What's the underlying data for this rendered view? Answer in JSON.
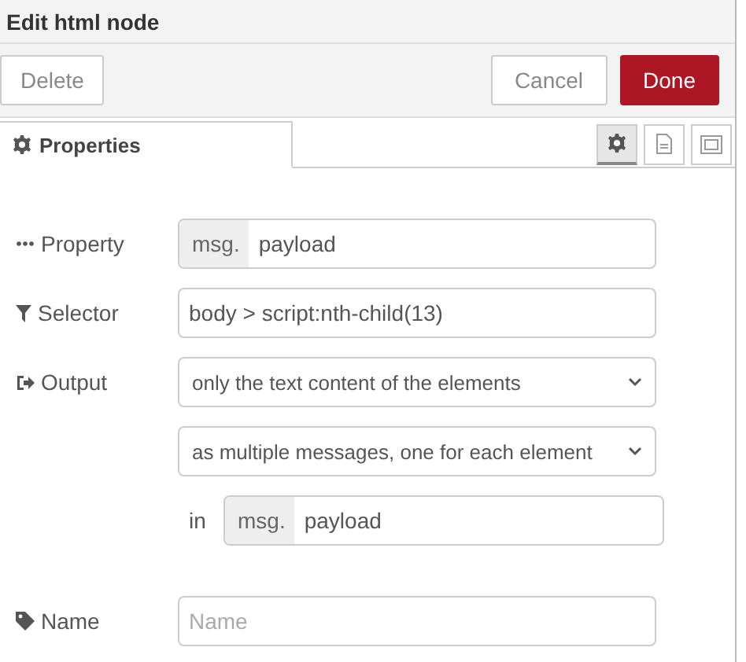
{
  "window": {
    "title": "Edit html node"
  },
  "buttons": [
    {
      "label": "Delete",
      "kind": "plain"
    },
    {
      "label": "Cancel",
      "kind": "plain"
    },
    {
      "label": "Done",
      "kind": "primary"
    }
  ],
  "tabs": [
    {
      "label": "Properties",
      "selected": true
    }
  ],
  "tab_icons": [
    {
      "selected": true
    },
    {
      "selected": false
    },
    {
      "selected": false
    }
  ],
  "form": [
    {
      "kind": "typed",
      "label": "Property",
      "prefix": "msg.",
      "value": "payload"
    },
    {
      "kind": "text",
      "label": "Selector",
      "value": "body > script:nth-child(13)"
    },
    {
      "kind": "select",
      "label": "Output",
      "value": "only the text content of the elements"
    },
    {
      "kind": "select",
      "value": "as multiple messages, one for each element"
    },
    {
      "kind": "in",
      "label": "in",
      "prefix": "msg.",
      "value": "payload"
    },
    {
      "kind": "text",
      "label": "Name",
      "placeholder": "Name"
    }
  ]
}
